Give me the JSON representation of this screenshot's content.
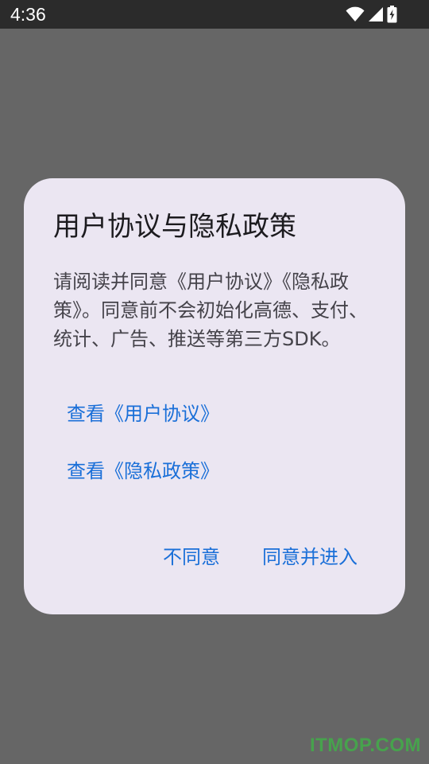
{
  "status_bar": {
    "time": "4:36",
    "icons": [
      "wifi-icon",
      "cellular-signal-icon",
      "battery-charging-icon"
    ]
  },
  "dialog": {
    "title": "用户协议与隐私政策",
    "message": "请阅读并同意《用户协议》《隐私政策》。同意前不会初始化高德、支付、统计、广告、推送等第三方SDK。",
    "link_user_agreement": "查看《用户协议》",
    "link_privacy_policy": "查看《隐私政策》",
    "disagree_label": "不同意",
    "agree_label": "同意并进入"
  },
  "watermark": "ITMOP.COM",
  "colors": {
    "status_bar_bg": "#2b2b2b",
    "scrim_bg": "#666666",
    "dialog_bg": "#ebe6f2",
    "accent": "#1a6fd8",
    "title_text": "#1c1b1f",
    "body_text": "#45434a",
    "watermark": "#2ed33a"
  }
}
